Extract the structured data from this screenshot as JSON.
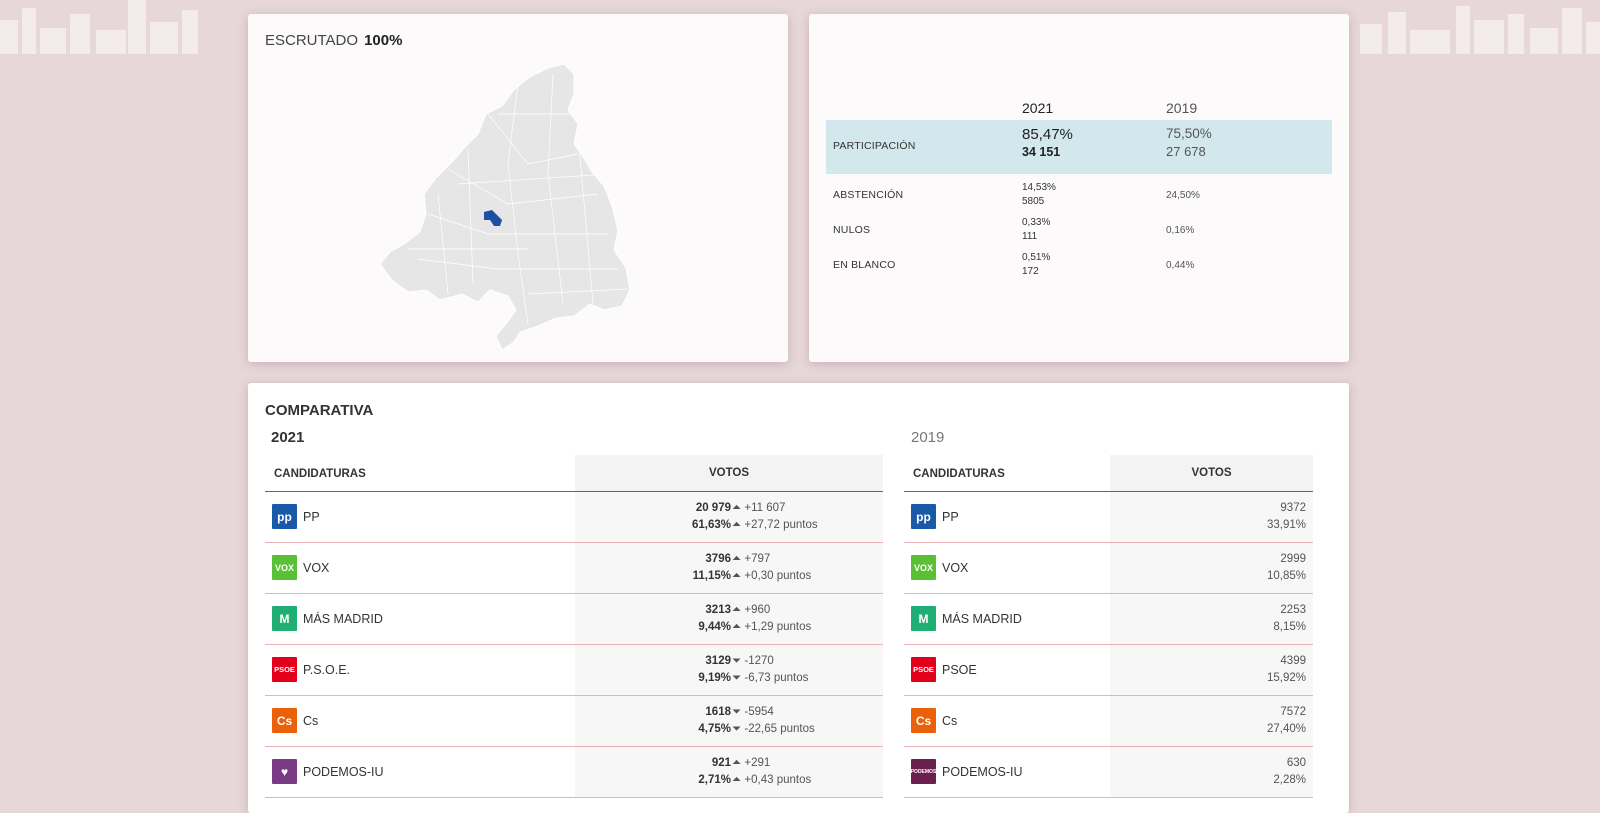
{
  "colors": {
    "background": "#e7d7d9",
    "accent_red": "#e0303a",
    "highlight_row": "#d3e8ec",
    "map_fill": "#e6e6e6",
    "map_selected": "#1f4fa3"
  },
  "map_card": {
    "escrutado_label": "ESCRUTADO",
    "escrutado_value": "100%"
  },
  "participation": {
    "year_current": "2021",
    "year_previous": "2019",
    "rows": [
      {
        "label": "PARTICIPACIÓN",
        "cur_pct": "85,47%",
        "cur_num": "34 151",
        "prev_pct": "75,50%",
        "prev_num": "27 678"
      },
      {
        "label": "ABSTENCIÓN",
        "cur_pct": "14,53%",
        "cur_num": "5805",
        "prev_pct": "24,50%"
      },
      {
        "label": "NULOS",
        "cur_pct": "0,33%",
        "cur_num": "111",
        "prev_pct": "0,16%"
      },
      {
        "label": "EN BLANCO",
        "cur_pct": "0,51%",
        "cur_num": "172",
        "prev_pct": "0,44%"
      }
    ]
  },
  "comparativa": {
    "title": "COMPARATIVA",
    "year_current": "2021",
    "year_previous": "2019",
    "col_candidaturas": "CANDIDATURAS",
    "col_votos": "VOTOS",
    "current": [
      {
        "party": "PP",
        "logo_text": "pp",
        "logo_color": "#1a58a8",
        "votes": "20 979",
        "vote_dir": "up",
        "vote_delta": "+11 607",
        "pct": "61,63%",
        "pct_dir": "up",
        "pct_delta": "+27,72 puntos"
      },
      {
        "party": "VOX",
        "logo_text": "VOX",
        "logo_color": "#5ac035",
        "votes": "3796",
        "vote_dir": "up",
        "vote_delta": "+797",
        "pct": "11,15%",
        "pct_dir": "up",
        "pct_delta": "+0,30 puntos"
      },
      {
        "party": "MÁS MADRID",
        "logo_text": "M",
        "logo_color": "#1fae74",
        "votes": "3213",
        "vote_dir": "up",
        "vote_delta": "+960",
        "pct": "9,44%",
        "pct_dir": "up",
        "pct_delta": "+1,29 puntos"
      },
      {
        "party": "P.S.O.E.",
        "logo_text": "PSOE",
        "logo_color": "#e3001b",
        "votes": "3129",
        "vote_dir": "down",
        "vote_delta": "-1270",
        "pct": "9,19%",
        "pct_dir": "down",
        "pct_delta": "-6,73 puntos"
      },
      {
        "party": "Cs",
        "logo_text": "Cs",
        "logo_color": "#eb6109",
        "votes": "1618",
        "vote_dir": "down",
        "vote_delta": "-5954",
        "pct": "4,75%",
        "pct_dir": "down",
        "pct_delta": "-22,65 puntos"
      },
      {
        "party": "PODEMOS-IU",
        "logo_text": "♥",
        "logo_color": "#7a3a85",
        "votes": "921",
        "vote_dir": "up",
        "vote_delta": "+291",
        "pct": "2,71%",
        "pct_dir": "up",
        "pct_delta": "+0,43 puntos"
      }
    ],
    "previous": [
      {
        "party": "PP",
        "logo_text": "pp",
        "logo_color": "#1a58a8",
        "votes": "9372",
        "pct": "33,91%"
      },
      {
        "party": "VOX",
        "logo_text": "VOX",
        "logo_color": "#5ac035",
        "votes": "2999",
        "pct": "10,85%"
      },
      {
        "party": "MÁS MADRID",
        "logo_text": "M",
        "logo_color": "#1fae74",
        "votes": "2253",
        "pct": "8,15%"
      },
      {
        "party": "PSOE",
        "logo_text": "PSOE",
        "logo_color": "#e3001b",
        "votes": "4399",
        "pct": "15,92%"
      },
      {
        "party": "Cs",
        "logo_text": "Cs",
        "logo_color": "#eb6109",
        "votes": "7572",
        "pct": "27,40%"
      },
      {
        "party": "PODEMOS-IU",
        "logo_text": "PODEMOS",
        "logo_color": "#6b1f4f",
        "votes": "630",
        "pct": "2,28%"
      }
    ]
  }
}
